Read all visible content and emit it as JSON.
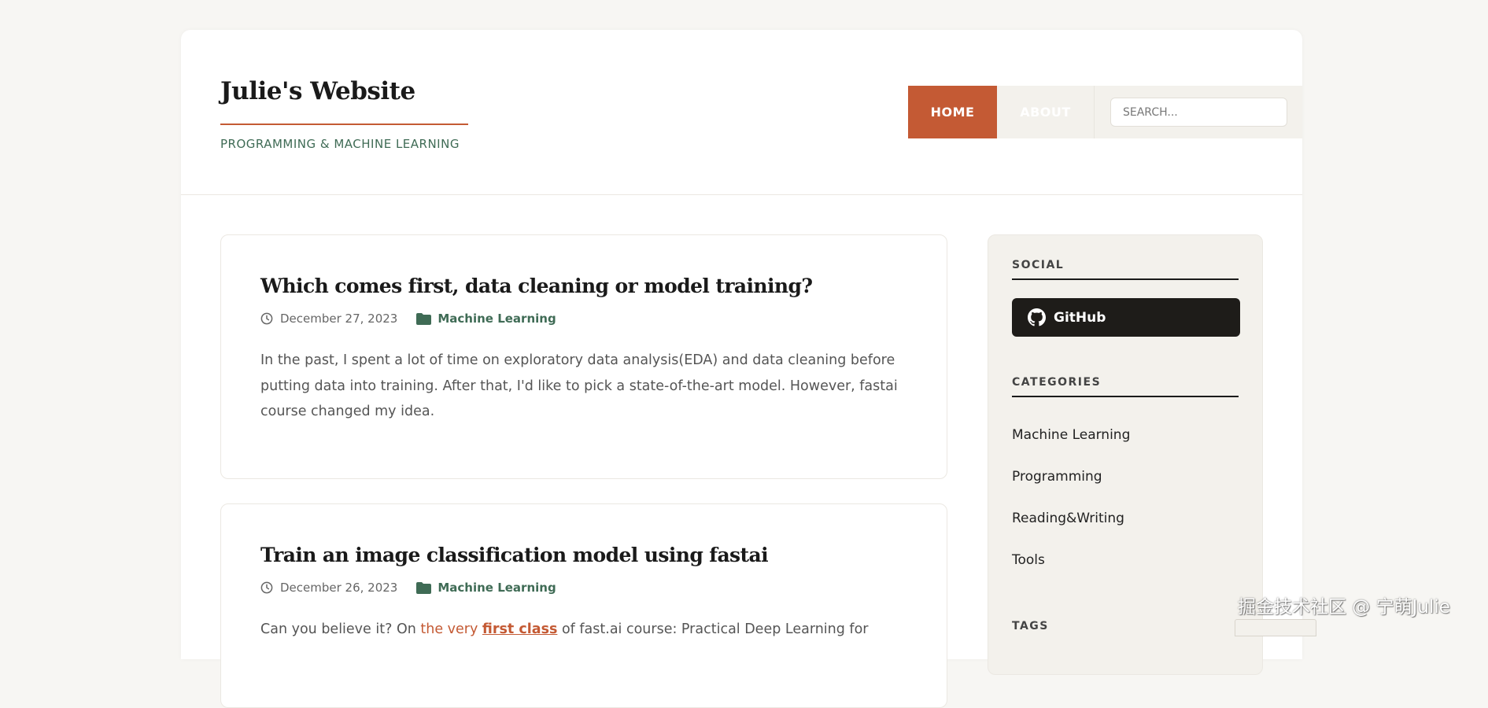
{
  "site": {
    "title": "Julie's Website",
    "tagline": "PROGRAMMING & MACHINE LEARNING"
  },
  "nav": {
    "items": [
      {
        "label": "HOME",
        "active": true
      },
      {
        "label": "ABOUT",
        "active": false
      }
    ],
    "search_placeholder": "SEARCH..."
  },
  "posts": [
    {
      "title": "Which comes first, data cleaning or model training?",
      "date": "December 27, 2023",
      "category": "Machine Learning",
      "excerpt": "In the past, I spent a lot of time on exploratory data analysis(EDA) and data cleaning before putting data into training. After that, I'd like to pick a state-of-the-art model. However, fastai course changed my idea."
    },
    {
      "title": "Train an image classification model using fastai",
      "date": "December 26, 2023",
      "category": "Machine Learning",
      "excerpt_start": "Can you believe it? On ",
      "excerpt_link": "the very ",
      "excerpt_link_bold": "first class",
      "excerpt_end": " of fast.ai course: Practical Deep Learning for"
    }
  ],
  "sidebar": {
    "social_title": "SOCIAL",
    "github_label": "GitHub",
    "categories_title": "CATEGORIES",
    "categories": [
      "Machine Learning",
      "Programming",
      "Reading&Writing",
      "Tools"
    ],
    "tags_title": "TAGS"
  },
  "colors": {
    "accent": "#c45a34",
    "green": "#3f6b55",
    "dark": "#1e1c19",
    "sidebar_bg": "#f3f1ec"
  },
  "watermark": "掘金技术社区 @ 宁萌Julie",
  "icons": [
    "clock-icon",
    "folder-icon",
    "github-icon"
  ]
}
